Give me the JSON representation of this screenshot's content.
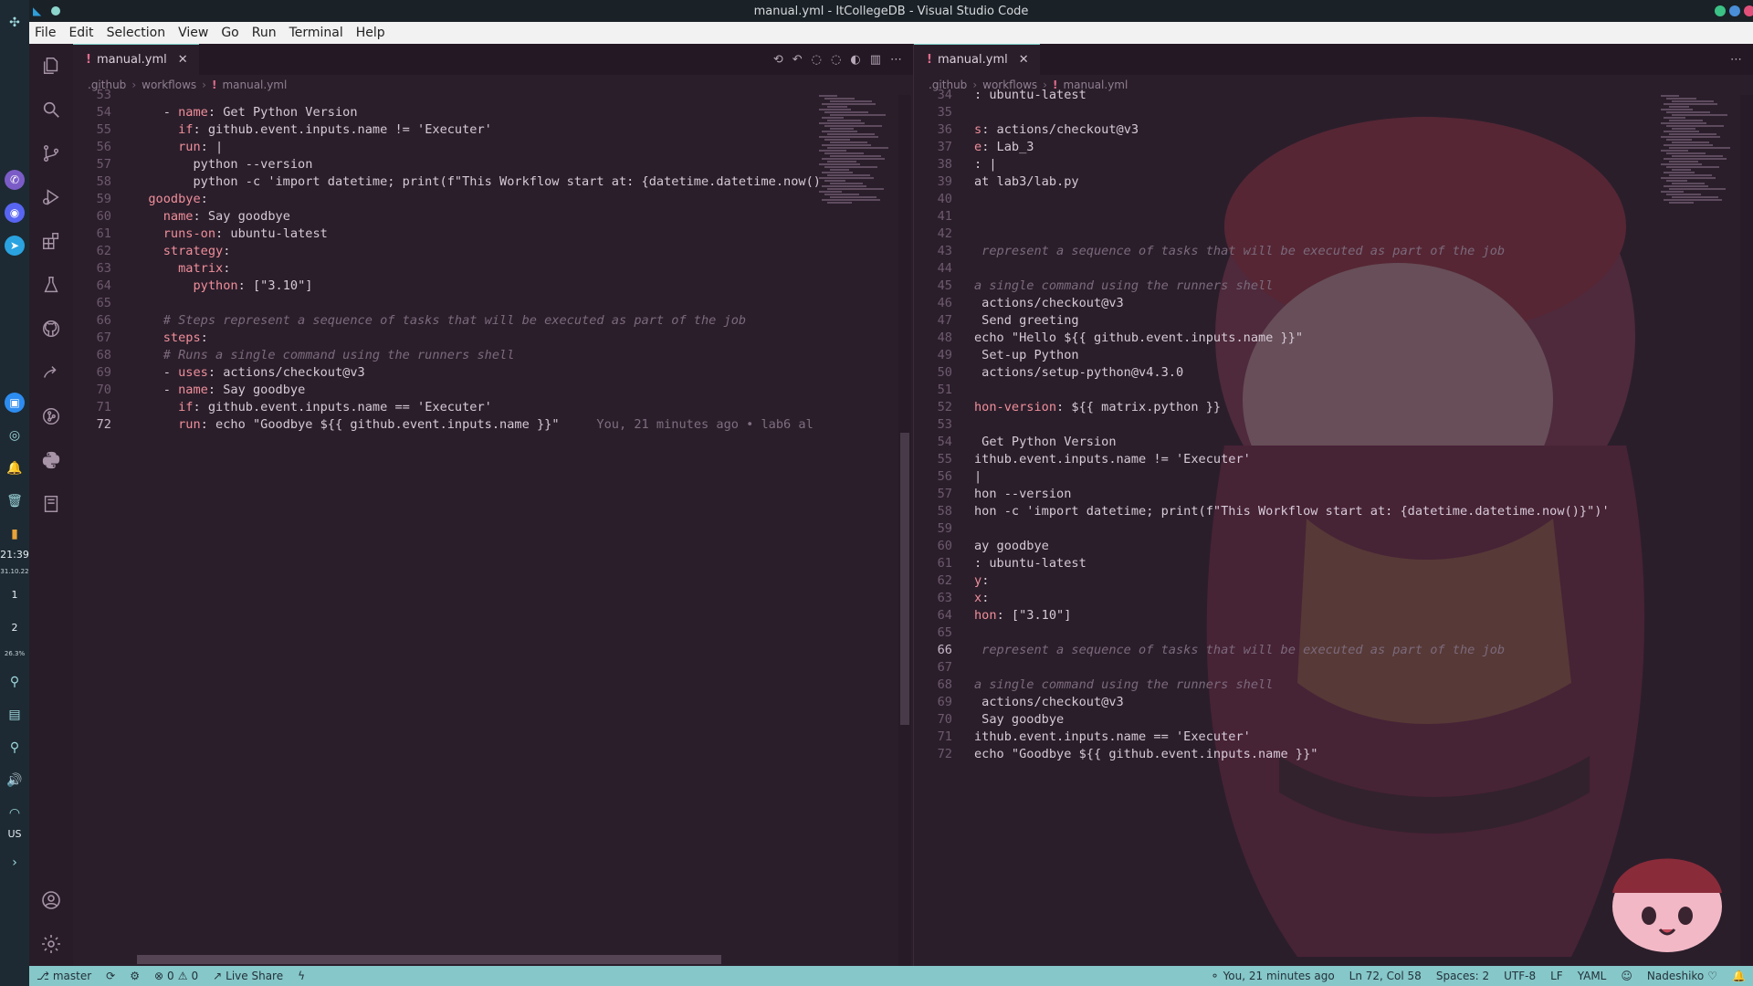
{
  "window": {
    "title": "manual.yml - ItCollegeDB - Visual Studio Code"
  },
  "menu": [
    "File",
    "Edit",
    "Selection",
    "View",
    "Go",
    "Run",
    "Terminal",
    "Help"
  ],
  "system": {
    "time": "21:39",
    "date": "31.10.22",
    "workspace_1": "1",
    "workspace_2": "2",
    "battery": "26.3%",
    "layout": "US"
  },
  "editor_left": {
    "tab": "manual.yml",
    "breadcrumb": [
      ".github",
      "workflows",
      "manual.yml"
    ],
    "blame": "You, 21 minutes ago • lab6 al",
    "lines": [
      {
        "n": "53",
        "text": ""
      },
      {
        "n": "54",
        "text": "    - name: Get Python Version"
      },
      {
        "n": "55",
        "text": "      if: github.event.inputs.name != 'Executer'"
      },
      {
        "n": "56",
        "text": "      run: |"
      },
      {
        "n": "57",
        "text": "        python --version"
      },
      {
        "n": "58",
        "text": "        python -c 'import datetime; print(f\"This Workflow start at: {datetime.datetime.now()"
      },
      {
        "n": "59",
        "text": "  goodbye:"
      },
      {
        "n": "60",
        "text": "    name: Say goodbye"
      },
      {
        "n": "61",
        "text": "    runs-on: ubuntu-latest"
      },
      {
        "n": "62",
        "text": "    strategy:"
      },
      {
        "n": "63",
        "text": "      matrix:"
      },
      {
        "n": "64",
        "text": "        python: [\"3.10\"]"
      },
      {
        "n": "65",
        "text": ""
      },
      {
        "n": "66",
        "text": "    # Steps represent a sequence of tasks that will be executed as part of the job"
      },
      {
        "n": "67",
        "text": "    steps:"
      },
      {
        "n": "68",
        "text": "    # Runs a single command using the runners shell"
      },
      {
        "n": "69",
        "text": "    - uses: actions/checkout@v3"
      },
      {
        "n": "70",
        "text": "    - name: Say goodbye"
      },
      {
        "n": "71",
        "text": "      if: github.event.inputs.name == 'Executer'"
      },
      {
        "n": "72",
        "text": "      run: echo \"Goodbye ${{ github.event.inputs.name }}\""
      }
    ]
  },
  "editor_right": {
    "tab": "manual.yml",
    "breadcrumb": [
      ".github",
      "workflows",
      "manual.yml"
    ],
    "lines": [
      {
        "n": "34",
        "text": ": ubuntu-latest"
      },
      {
        "n": "35",
        "text": ""
      },
      {
        "n": "36",
        "text": "s: actions/checkout@v3"
      },
      {
        "n": "37",
        "text": "e: Lab_3"
      },
      {
        "n": "38",
        "text": ": |"
      },
      {
        "n": "39",
        "text": "at lab3/lab.py"
      },
      {
        "n": "40",
        "text": ""
      },
      {
        "n": "41",
        "text": ""
      },
      {
        "n": "42",
        "text": ""
      },
      {
        "n": "43",
        "text": " represent a sequence of tasks that will be executed as part of the job"
      },
      {
        "n": "44",
        "text": ""
      },
      {
        "n": "45",
        "text": "a single command using the runners shell"
      },
      {
        "n": "46",
        "text": " actions/checkout@v3"
      },
      {
        "n": "47",
        "text": " Send greeting"
      },
      {
        "n": "48",
        "text": "echo \"Hello ${{ github.event.inputs.name }}\""
      },
      {
        "n": "49",
        "text": " Set-up Python"
      },
      {
        "n": "50",
        "text": " actions/setup-python@v4.3.0"
      },
      {
        "n": "51",
        "text": ""
      },
      {
        "n": "52",
        "text": "hon-version: ${{ matrix.python }}"
      },
      {
        "n": "53",
        "text": ""
      },
      {
        "n": "54",
        "text": " Get Python Version"
      },
      {
        "n": "55",
        "text": "ithub.event.inputs.name != 'Executer'"
      },
      {
        "n": "56",
        "text": "|"
      },
      {
        "n": "57",
        "text": "hon --version"
      },
      {
        "n": "58",
        "text": "hon -c 'import datetime; print(f\"This Workflow start at: {datetime.datetime.now()}\")'"
      },
      {
        "n": "59",
        "text": ""
      },
      {
        "n": "60",
        "text": "ay goodbye"
      },
      {
        "n": "61",
        "text": ": ubuntu-latest"
      },
      {
        "n": "62",
        "text": "y:"
      },
      {
        "n": "63",
        "text": "x:"
      },
      {
        "n": "64",
        "text": "hon: [\"3.10\"]"
      },
      {
        "n": "65",
        "text": ""
      },
      {
        "n": "66",
        "text": " represent a sequence of tasks that will be executed as part of the job"
      },
      {
        "n": "67",
        "text": ""
      },
      {
        "n": "68",
        "text": "a single command using the runners shell"
      },
      {
        "n": "69",
        "text": " actions/checkout@v3"
      },
      {
        "n": "70",
        "text": " Say goodbye"
      },
      {
        "n": "71",
        "text": "ithub.event.inputs.name == 'Executer'"
      },
      {
        "n": "72",
        "text": "echo \"Goodbye ${{ github.event.inputs.name }}\""
      }
    ]
  },
  "statusbar": {
    "branch": "master",
    "errors": "0",
    "warnings": "0",
    "live_share": "Live Share",
    "blame": "You, 21 minutes ago",
    "cursor": "Ln 72, Col 58",
    "spaces": "Spaces: 2",
    "encoding": "UTF-8",
    "eol": "LF",
    "language": "YAML",
    "theme": "Nadeshiko"
  },
  "colors": {
    "accent": "#86c7c9",
    "keyword": "#ef8f9a",
    "editor_bg": "#2b1e2b"
  }
}
